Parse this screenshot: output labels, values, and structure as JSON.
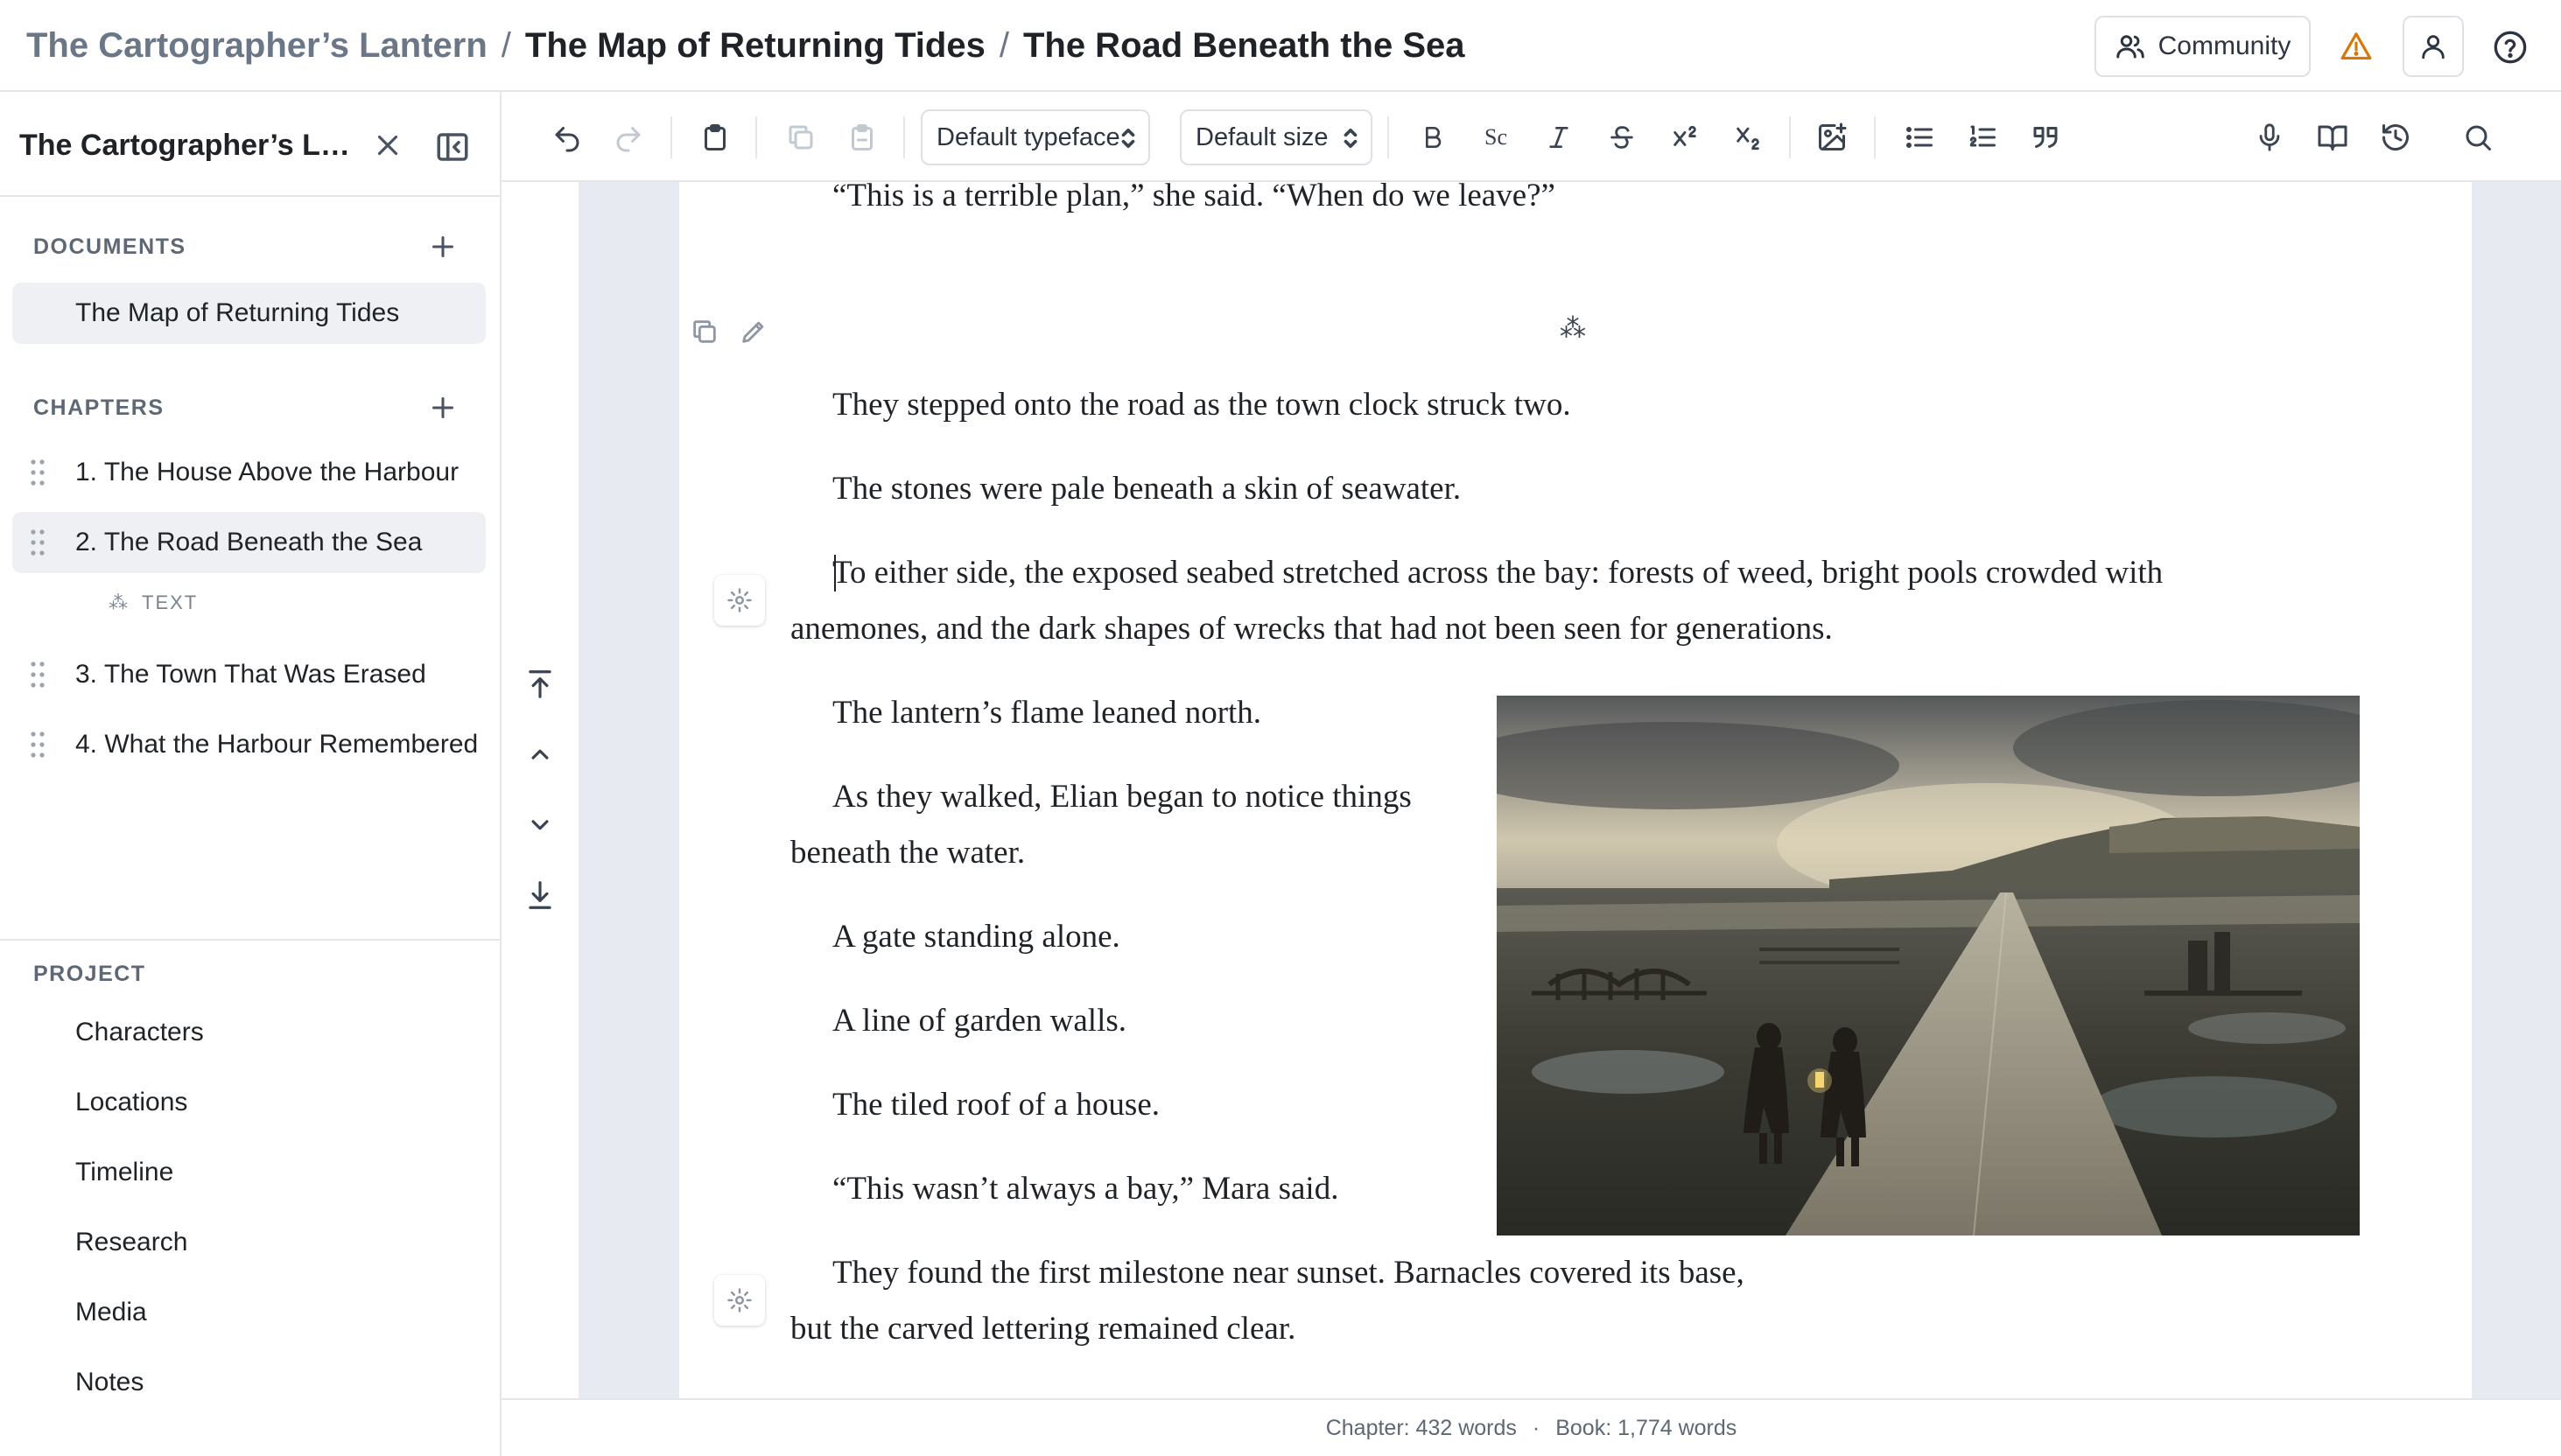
{
  "breadcrumb": {
    "project": "The Cartographer’s Lantern",
    "document": "The Map of Returning Tides",
    "chapter": "The Road Beneath the Sea",
    "separator": "/"
  },
  "topbar": {
    "community_label": "Community",
    "icons": [
      "users-icon",
      "warning-icon",
      "user-icon",
      "help-icon"
    ],
    "warning_color": "#d97706"
  },
  "sidebar": {
    "title": "The Cartographer’s Lantern",
    "documents_label": "DOCUMENTS",
    "documents": [
      {
        "label": "The Map of Returning Tides",
        "active": true
      }
    ],
    "chapters_label": "CHAPTERS",
    "chapters": [
      {
        "label": "1. The House Above the Harbour",
        "active": false
      },
      {
        "label": "2. The Road Beneath the Sea",
        "active": true
      },
      {
        "label": "3. The Town That Was Erased",
        "active": false
      },
      {
        "label": "4. What the Harbour Remembered",
        "active": false
      }
    ],
    "chapter_subitem": {
      "icon": "asterism-icon",
      "label": "TEXT"
    },
    "project_label": "PROJECT",
    "project_items": [
      "Characters",
      "Locations",
      "Timeline",
      "Research",
      "Media",
      "Notes"
    ]
  },
  "toolbar": {
    "typeface": "Default typeface",
    "size": "Default size",
    "small_caps_label": "Sc",
    "disabled": [
      "redo",
      "copy",
      "paste-special"
    ],
    "icons": [
      "undo-icon",
      "redo-icon",
      "clipboard-icon",
      "copy-icon",
      "paste-icon",
      "bold-icon",
      "small-caps-icon",
      "italic-icon",
      "strikethrough-icon",
      "superscript-icon",
      "subscript-icon",
      "insert-image-icon",
      "bullet-list-icon",
      "numbered-list-icon",
      "quote-icon",
      "microphone-icon",
      "book-icon",
      "history-icon",
      "search-icon"
    ]
  },
  "editor": {
    "paragraphs": [
      "“This is a terrible plan,” she said. “When do we leave?”",
      "They stepped onto the road as the town clock struck two.",
      "The stones were pale beneath a skin of seawater.",
      "To either side, the exposed seabed stretched across the bay: forests of weed, bright pools crowded with anemones, and the dark shapes of wrecks that had not been seen for generations.",
      "The lantern’s flame leaned north.",
      "As they walked, Elian began to notice things beneath the water.",
      "A gate standing alone.",
      "A line of garden walls.",
      "The tiled roof of a house.",
      "“This wasn’t always a bay,” Mara said.",
      "They found the first milestone near sunset. Barnacles covered its base, but the carved lettering remained clear."
    ],
    "scene_break": "⁂",
    "image": {
      "subject": "two travellers with a lantern walking a stone causeway across an exposed seabed toward distant cliffs"
    }
  },
  "status": {
    "chapter_words": "Chapter: 432 words",
    "separator": "·",
    "book_words": "Book: 1,774 words"
  }
}
